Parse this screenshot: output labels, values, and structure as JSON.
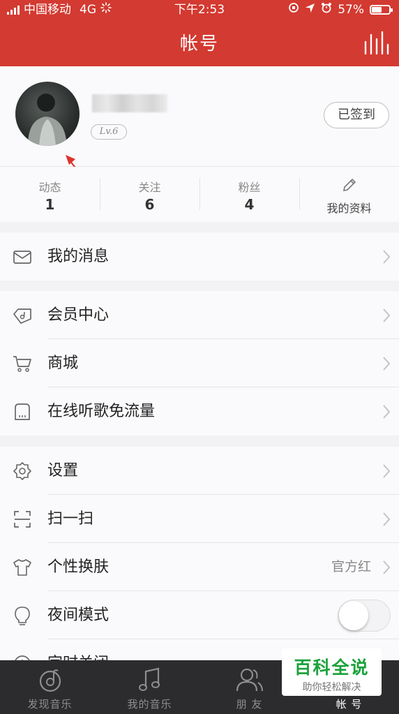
{
  "status_bar": {
    "carrier": "中国移动",
    "network": "4G",
    "time": "下午2:53",
    "battery": "57%"
  },
  "header": {
    "title": "帐号"
  },
  "profile": {
    "level": "Lv.6",
    "signin_label": "已签到"
  },
  "stats": [
    {
      "label": "动态",
      "value": "1"
    },
    {
      "label": "关注",
      "value": "6"
    },
    {
      "label": "粉丝",
      "value": "4"
    }
  ],
  "edit_profile_label": "我的资料",
  "menu": {
    "messages": "我的消息",
    "vip_center": "会员中心",
    "store": "商城",
    "free_data": "在线听歌免流量",
    "settings": "设置",
    "scan": "扫一扫",
    "skin": "个性换肤",
    "skin_value": "官方红",
    "night_mode": "夜间模式",
    "timer": "定时关闭"
  },
  "tabs": [
    {
      "label": "发现音乐",
      "icon": "discover-music-icon"
    },
    {
      "label": "我的音乐",
      "icon": "music-note-icon"
    },
    {
      "label": "朋 友",
      "icon": "friends-icon"
    },
    {
      "label": "帐 号",
      "icon": "account-icon"
    }
  ],
  "watermark": {
    "title": "百科全说",
    "subtitle": "助你轻松解决"
  },
  "colors": {
    "brand_red": "#d33a31",
    "tab_bg": "#2c2c2e",
    "watermark_green": "#1aa23a"
  }
}
